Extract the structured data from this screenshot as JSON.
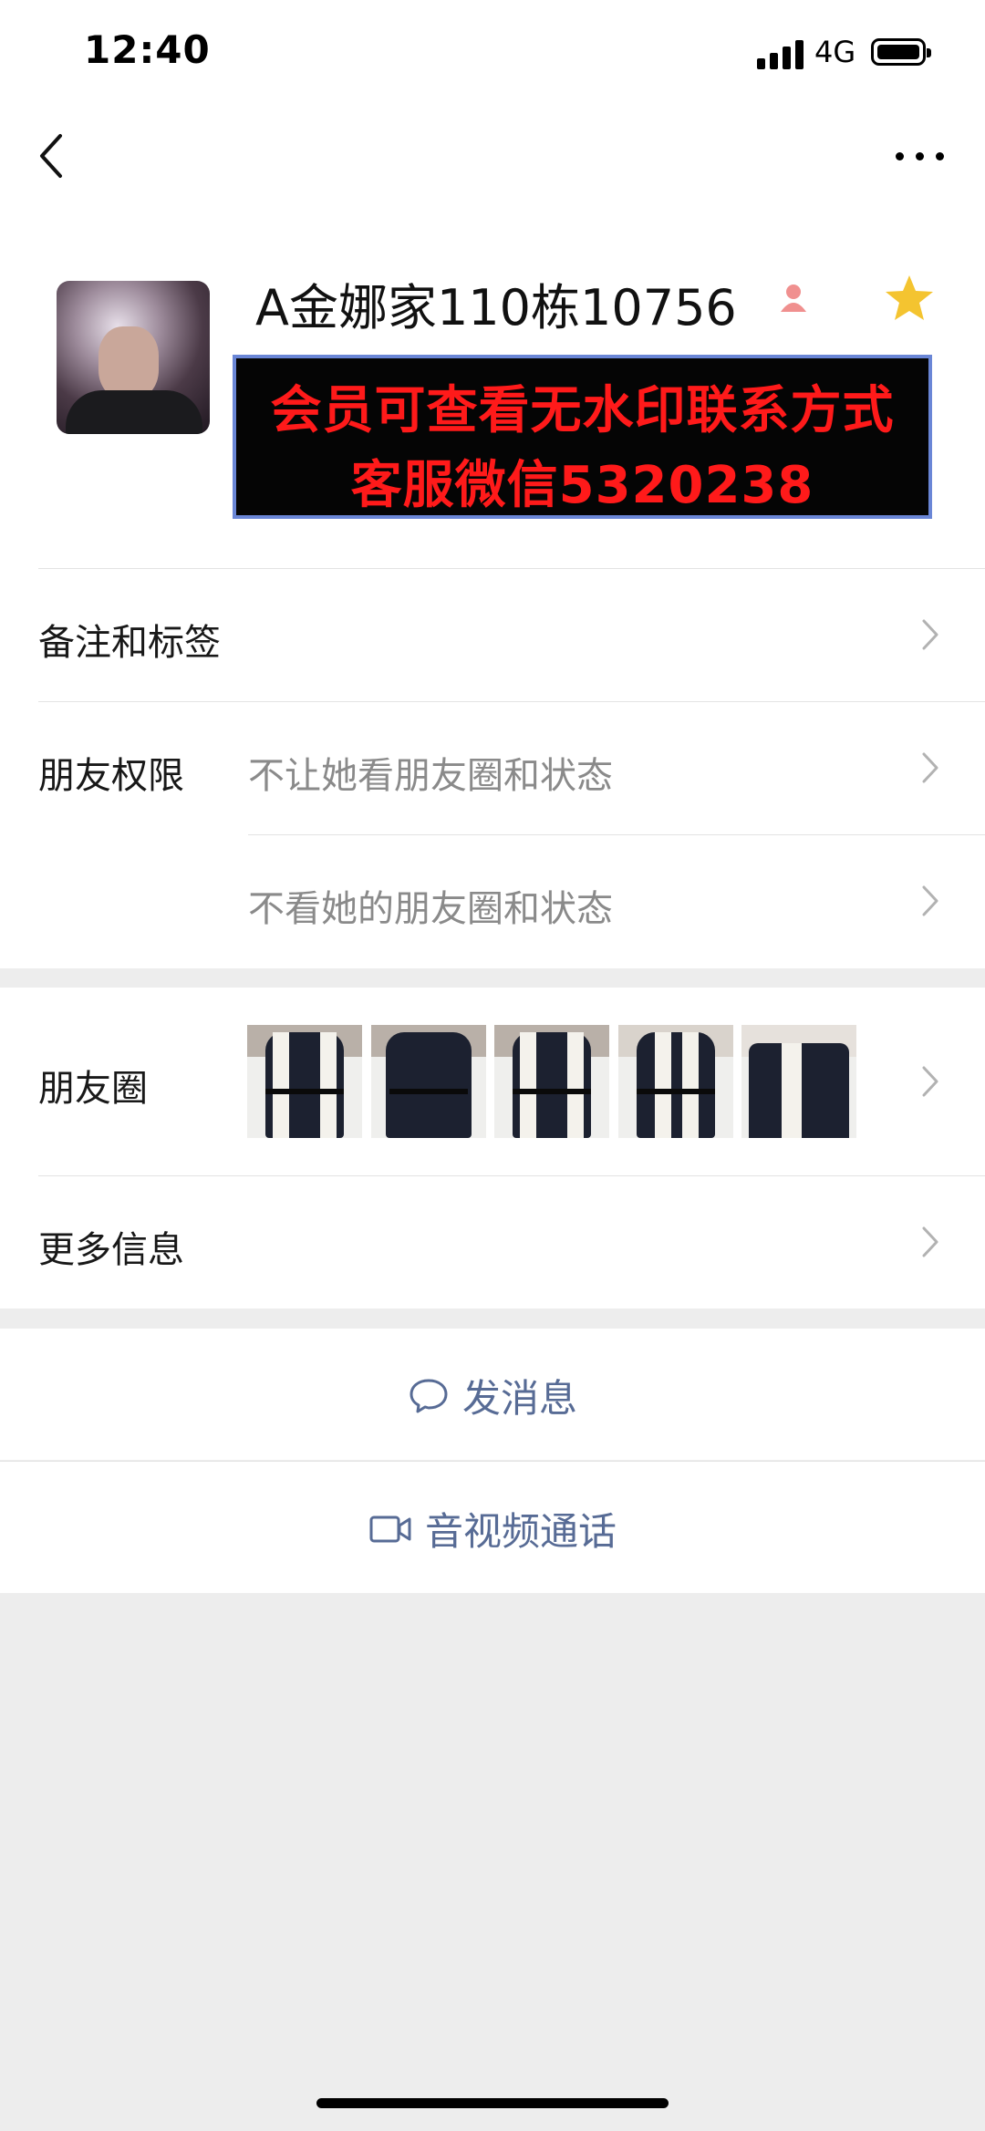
{
  "status_bar": {
    "time": "12:40",
    "network": "4G"
  },
  "profile": {
    "name": "A金娜家110栋10756",
    "watermark_line1": "会员可查看无水印联系方式",
    "watermark_line2": "客服微信5320238"
  },
  "rows": {
    "remark_label": "备注和标签",
    "permission_label": "朋友权限",
    "permission_value_1": "不让她看朋友圈和状态",
    "permission_value_2": "不看她的朋友圈和状态",
    "moments_label": "朋友圈",
    "more_info_label": "更多信息"
  },
  "actions": {
    "message": "发消息",
    "call": "音视频通话"
  },
  "colors": {
    "link": "#576b95",
    "star": "#f4c430",
    "female_icon": "#f0908f",
    "watermark_text": "#ff1a1a",
    "background": "#ededed"
  },
  "icons": [
    "back-arrow-icon",
    "more-icon",
    "female-icon",
    "star-icon",
    "chevron-right-icon",
    "chat-bubble-icon",
    "video-camera-icon"
  ]
}
